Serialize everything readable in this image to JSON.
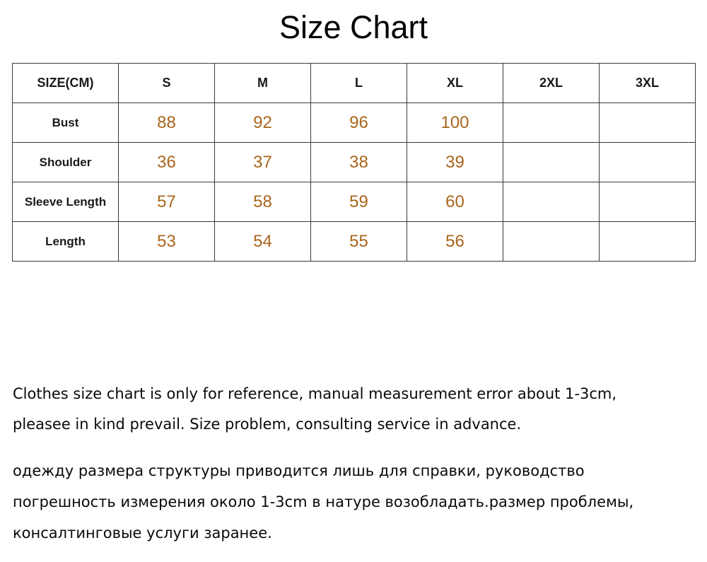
{
  "title": "Size Chart",
  "chart_data": {
    "type": "table",
    "title": "Size Chart",
    "unit": "CM",
    "columns": [
      "SIZE(CM)",
      "S",
      "M",
      "L",
      "XL",
      "2XL",
      "3XL"
    ],
    "rows": [
      {
        "label": "Bust",
        "values": [
          "88",
          "92",
          "96",
          "100",
          "",
          ""
        ]
      },
      {
        "label": "Shoulder",
        "values": [
          "36",
          "37",
          "38",
          "39",
          "",
          ""
        ]
      },
      {
        "label": "Sleeve Length",
        "values": [
          "57",
          "58",
          "59",
          "60",
          "",
          ""
        ]
      },
      {
        "label": "Length",
        "values": [
          "53",
          "54",
          "55",
          "56",
          "",
          ""
        ]
      }
    ],
    "value_color": "#a9651c",
    "header_color": "#1a1a1a",
    "border_color": "#3a3a3a",
    "empty_columns": [
      "2XL",
      "3XL"
    ]
  },
  "table": {
    "headers": {
      "h0": "SIZE(CM)",
      "h1": "S",
      "h2": "M",
      "h3": "L",
      "h4": "XL",
      "h5": "2XL",
      "h6": "3XL"
    },
    "rows": {
      "r0": {
        "label": "Bust",
        "v1": "88",
        "v2": "92",
        "v3": "96",
        "v4": "100",
        "v5": "",
        "v6": ""
      },
      "r1": {
        "label": "Shoulder",
        "v1": "36",
        "v2": "37",
        "v3": "38",
        "v4": "39",
        "v5": "",
        "v6": ""
      },
      "r2": {
        "label": "Sleeve Length",
        "v1": "57",
        "v2": "58",
        "v3": "59",
        "v4": "60",
        "v5": "",
        "v6": ""
      },
      "r3": {
        "label": "Length",
        "v1": "53",
        "v2": "54",
        "v3": "55",
        "v4": "56",
        "v5": "",
        "v6": ""
      }
    }
  },
  "notes": {
    "en_line1": "Clothes size chart is only for reference, manual measurement error about 1-3cm,",
    "en_line2": "pleasee in kind prevail. Size problem, consulting service in advance.",
    "ru_line1": "одежду размера структуры приводится лишь для справки, руководство",
    "ru_line2": "погрешность измерения около 1-3cm в натуре возобладать.размер проблемы,",
    "ru_line3": "консалтинговые услуги заранее."
  }
}
